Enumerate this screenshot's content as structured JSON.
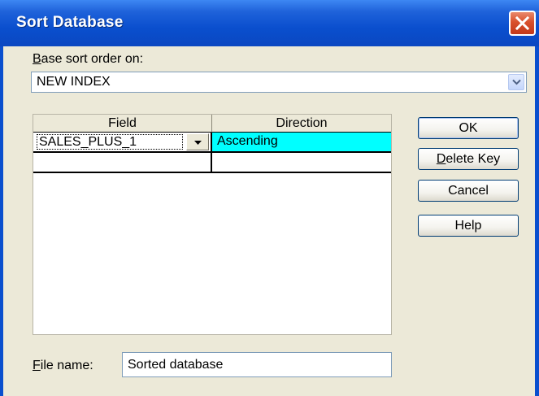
{
  "window": {
    "title": "Sort Database",
    "close_icon": "close-icon"
  },
  "sort_order": {
    "label_first": "B",
    "label_rest": "ase sort order on:",
    "value": "NEW INDEX",
    "dropdown_icon": "chevron-down-icon"
  },
  "grid": {
    "headers": [
      "Field",
      "Direction"
    ],
    "rows": [
      {
        "field": "SALES_PLUS_1",
        "direction": "Ascending"
      },
      {
        "field": "",
        "direction": ""
      }
    ],
    "dropdown_icon": "triangle-down-icon",
    "highlight_color": "#00ffff"
  },
  "buttons": {
    "ok": "OK",
    "delete_first": "D",
    "delete_rest": "elete Key",
    "cancel": "Cancel",
    "help": "Help"
  },
  "file": {
    "label_first": "F",
    "label_rest": "ile name:",
    "value": "Sorted database"
  },
  "colors": {
    "titlebar": "#0a4fce",
    "dialog_bg": "#ece9d8",
    "close_button": "#d9502c"
  }
}
